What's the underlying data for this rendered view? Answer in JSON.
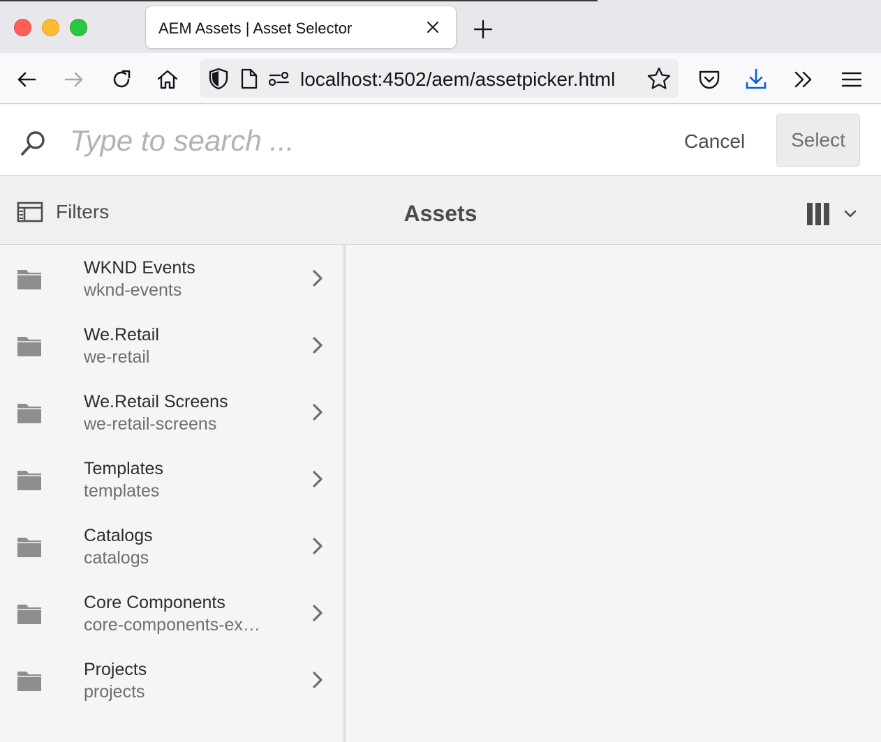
{
  "browser": {
    "tab_title": "AEM Assets | Asset Selector",
    "url": "localhost:4502/aem/assetpicker.html",
    "download_accent": "#0060df"
  },
  "search": {
    "placeholder": "Type to search ...",
    "value": ""
  },
  "toolbar": {
    "cancel_label": "Cancel",
    "select_label": "Select"
  },
  "actionbar": {
    "filters_label": "Filters",
    "title": "Assets"
  },
  "folders": [
    {
      "title": "WKND Events",
      "name": "wknd-events"
    },
    {
      "title": "We.Retail",
      "name": "we-retail"
    },
    {
      "title": "We.Retail Screens",
      "name": "we-retail-screens"
    },
    {
      "title": "Templates",
      "name": "templates"
    },
    {
      "title": "Catalogs",
      "name": "catalogs"
    },
    {
      "title": "Core Components",
      "name": "core-components-exa..."
    },
    {
      "title": "Projects",
      "name": "projects"
    }
  ]
}
